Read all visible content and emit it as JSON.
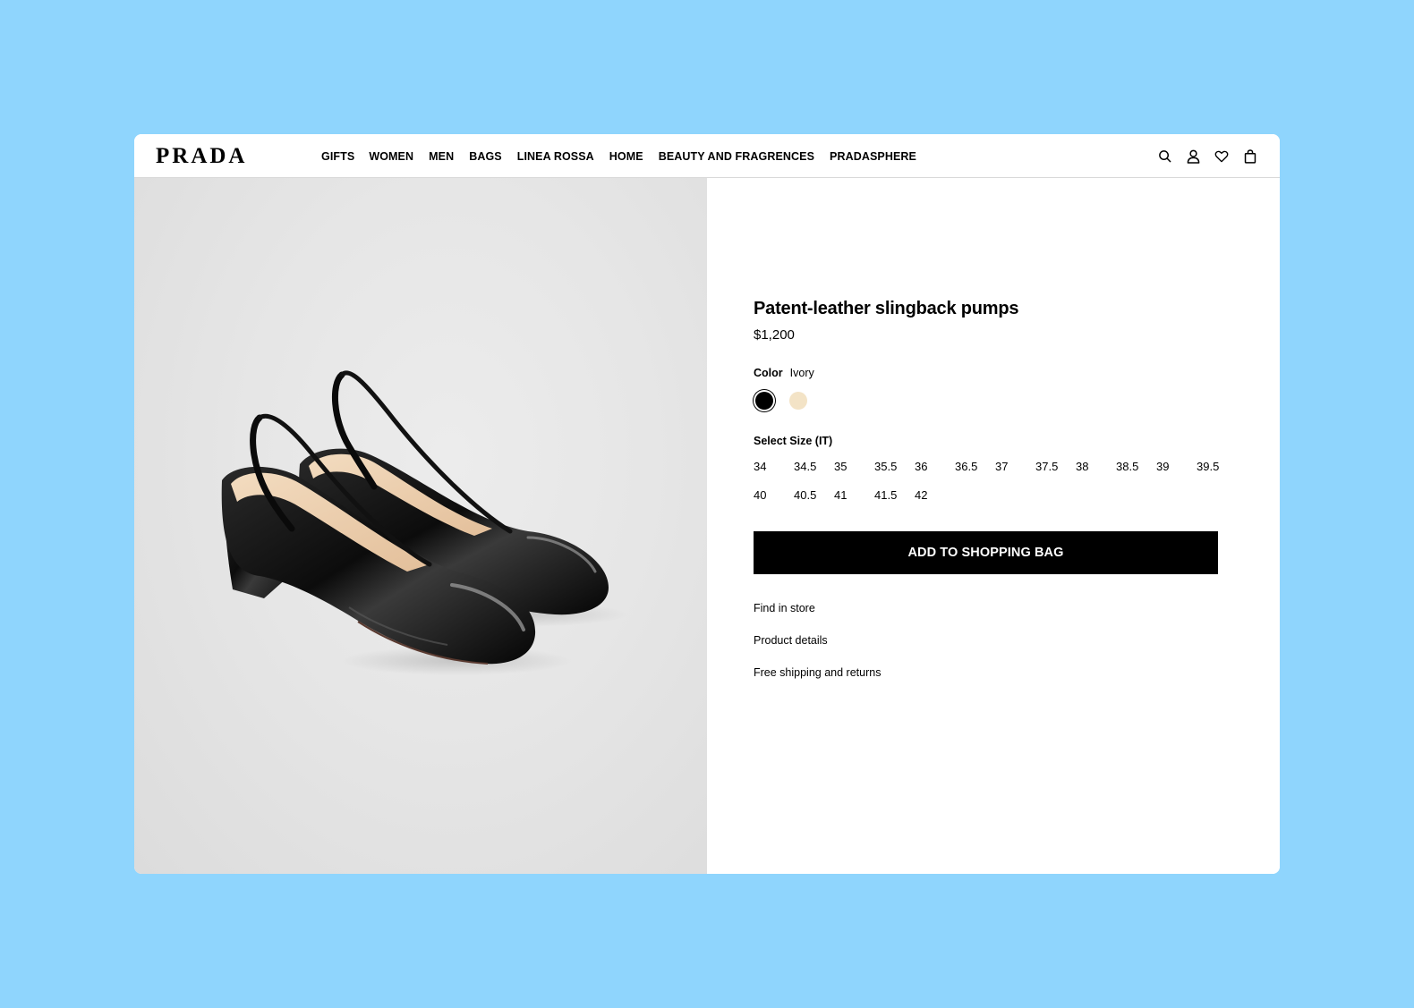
{
  "brand": {
    "logo": "PRADA"
  },
  "nav": {
    "items": [
      {
        "label": "GIFTS"
      },
      {
        "label": "WOMEN"
      },
      {
        "label": "MEN"
      },
      {
        "label": "BAGS"
      },
      {
        "label": "LINEA ROSSA"
      },
      {
        "label": "HOME"
      },
      {
        "label": "BEAUTY AND FRAGRENCES"
      },
      {
        "label": "PRADASPHERE"
      }
    ]
  },
  "header_icons": [
    "search-icon",
    "account-icon",
    "wishlist-icon",
    "shopping-bag-icon"
  ],
  "product": {
    "name": "Patent-leather slingback pumps",
    "price": "$1,200",
    "color_label": "Color",
    "color_value": "Ivory",
    "colors": [
      {
        "name": "black",
        "hex": "#000000",
        "selected": true
      },
      {
        "name": "ivory",
        "hex": "#f3e3c6",
        "selected": false
      }
    ],
    "size_label": "Select Size (IT)",
    "sizes": [
      "34",
      "34.5",
      "35",
      "35.5",
      "36",
      "36.5",
      "37",
      "37.5",
      "38",
      "38.5",
      "39",
      "39.5",
      "40",
      "40.5",
      "41",
      "41.5",
      "42"
    ],
    "add_to_bag": "ADD TO SHOPPING BAG",
    "links": {
      "find_in_store": "Find in store",
      "product_details": "Product details",
      "shipping": "Free shipping and returns"
    }
  },
  "colors": {
    "page_background": "#8fd5fd",
    "button": "#000000",
    "image_background": "#e6e6e6"
  }
}
